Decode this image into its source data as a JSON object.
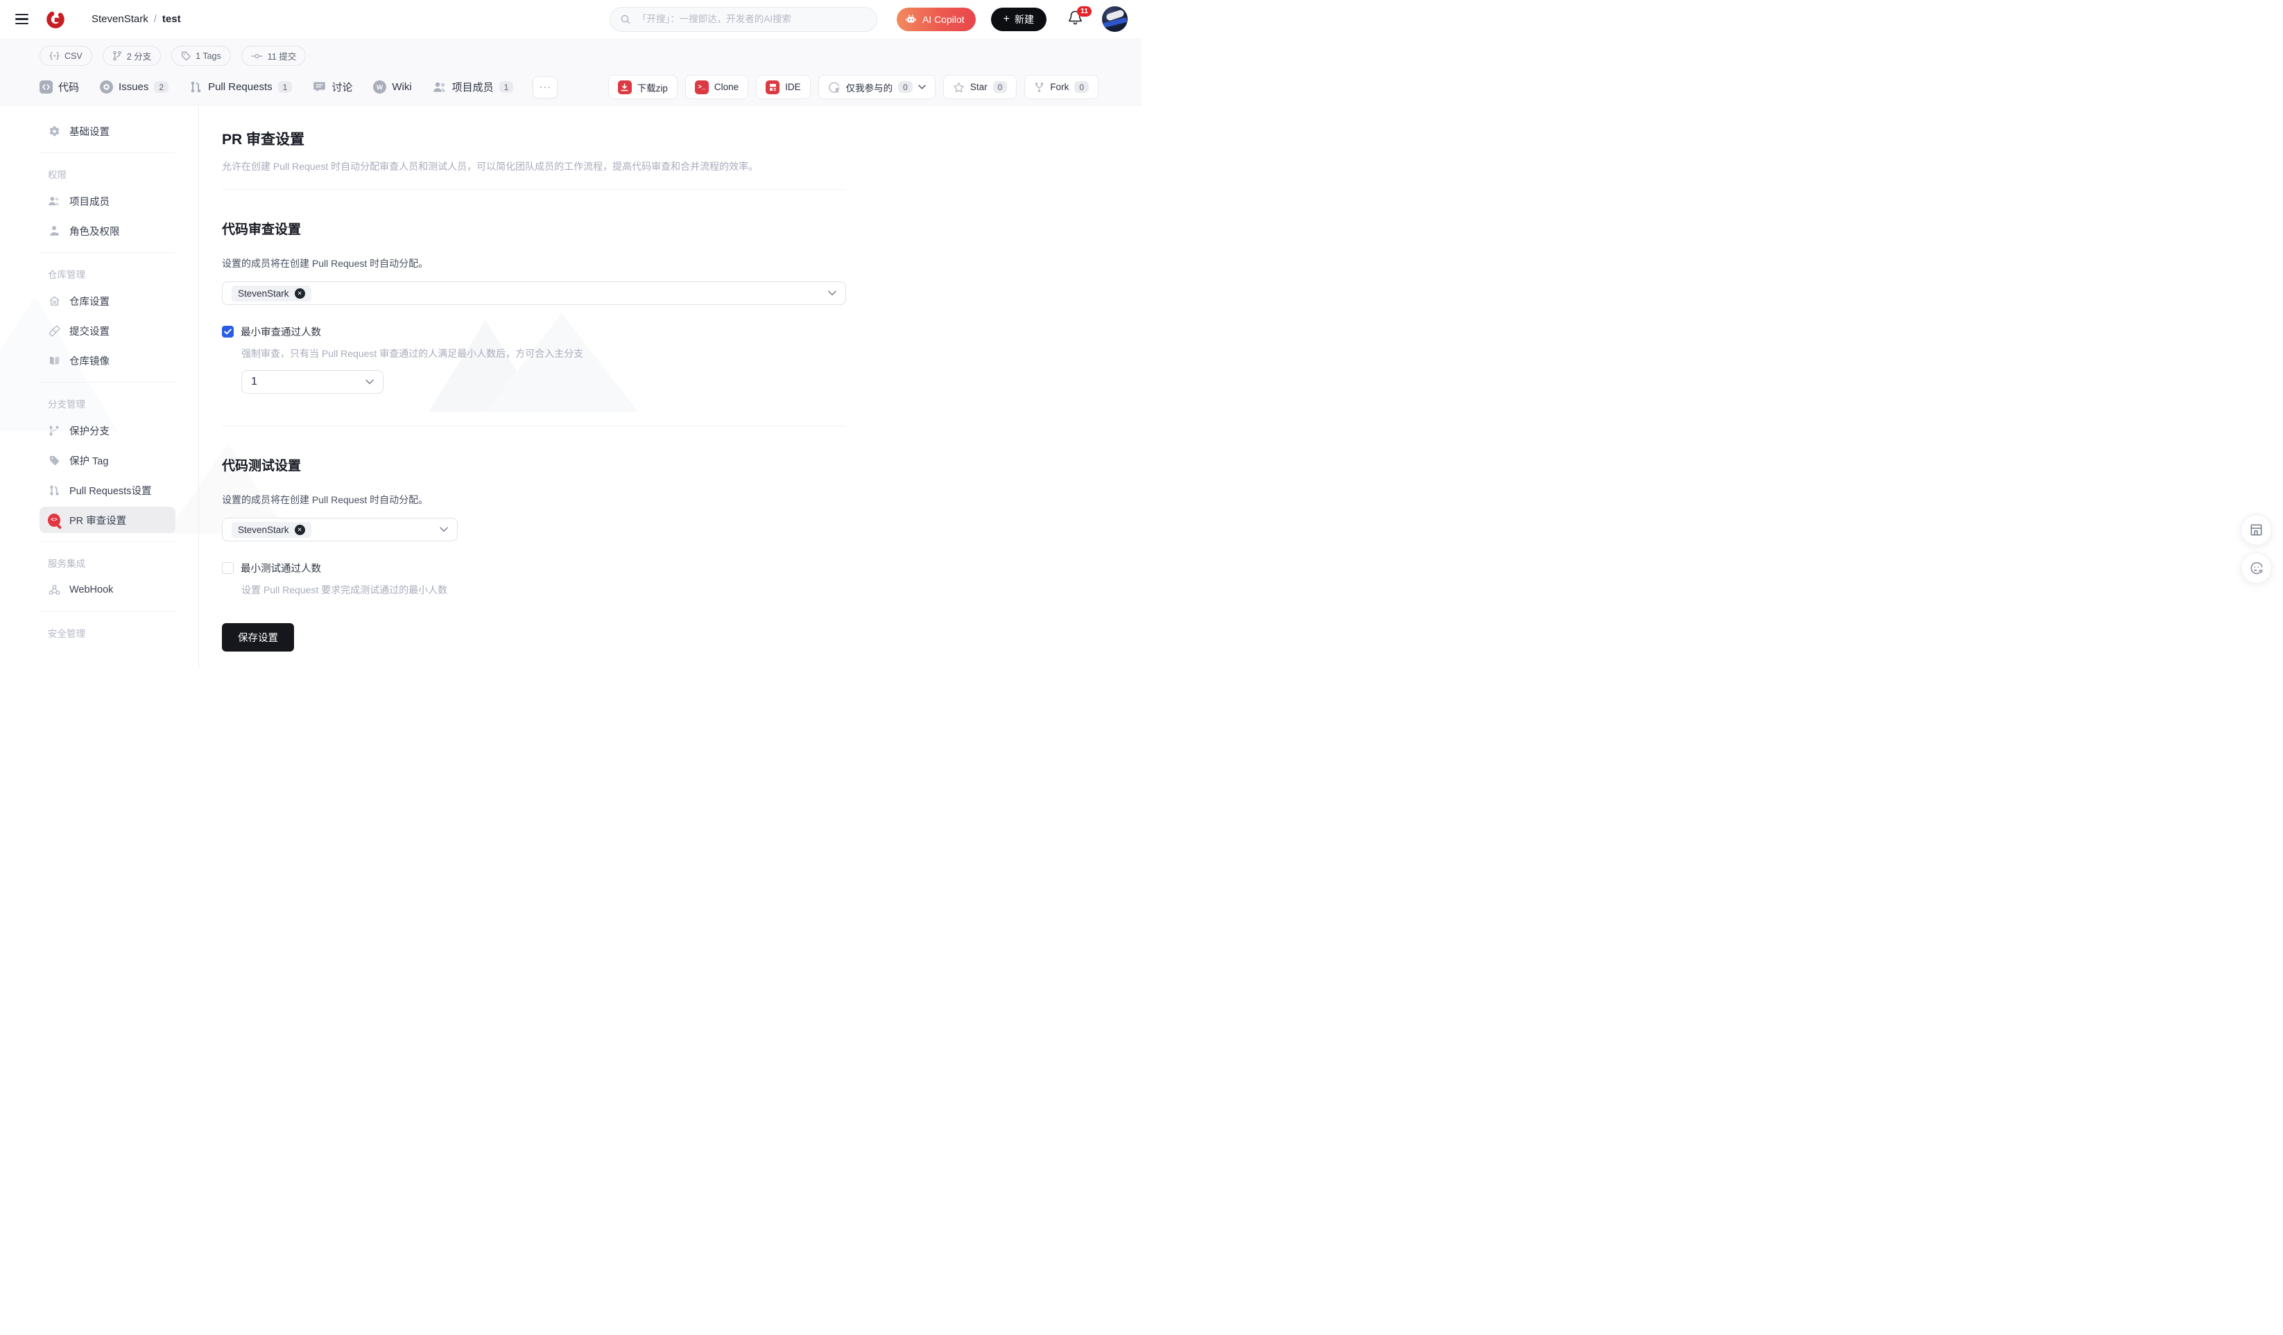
{
  "colors": {
    "brand_red": "#c71d23",
    "button_icon_red": "#dc3a42",
    "copilot_gradient_start": "#f28a5e",
    "copilot_gradient_end": "#e8464b",
    "notification_badge_red": "#e62129",
    "checkbox_blue": "#2b5ce6",
    "save_button_black": "#15171c",
    "active_item_bg": "#ededf0"
  },
  "header": {
    "breadcrumb": {
      "owner": "StevenStark",
      "separator": "/",
      "repo": "test"
    },
    "search_placeholder": "「开搜」：一搜即达，开发者的AI搜索",
    "ai_copilot_label": "AI Copilot",
    "new_label": "新建",
    "new_plus": "+",
    "notification_count": "11"
  },
  "repo": {
    "stats": [
      {
        "icon": "code-language-icon",
        "label": "CSV"
      },
      {
        "icon": "branch-icon",
        "label": "2 分支"
      },
      {
        "icon": "tag-icon",
        "label": "1 Tags"
      },
      {
        "icon": "commit-icon",
        "label": "11 提交"
      }
    ],
    "tabs": [
      {
        "label": "代码"
      },
      {
        "label": "Issues",
        "count": "2"
      },
      {
        "label": "Pull Requests",
        "count": "1"
      },
      {
        "label": "讨论"
      },
      {
        "label": "Wiki"
      },
      {
        "label": "项目成员",
        "count": "1"
      }
    ],
    "more_label": "···",
    "actions": {
      "download_label": "下载zip",
      "clone_label": "Clone",
      "ide_label": "IDE",
      "watch_label": "仅我参与的",
      "watch_count": "0",
      "star_label": "Star",
      "star_count": "0",
      "fork_label": "Fork",
      "fork_count": "0"
    }
  },
  "sidebar": {
    "groups": [
      {
        "items": [
          {
            "label": "基础设置"
          }
        ]
      },
      {
        "header": "权限",
        "items": [
          {
            "label": "项目成员"
          },
          {
            "label": "角色及权限"
          }
        ]
      },
      {
        "header": "仓库管理",
        "items": [
          {
            "label": "仓库设置"
          },
          {
            "label": "提交设置"
          },
          {
            "label": "仓库镜像"
          }
        ]
      },
      {
        "header": "分支管理",
        "items": [
          {
            "label": "保护分支"
          },
          {
            "label": "保护 Tag"
          },
          {
            "label": "Pull Requests设置"
          },
          {
            "label": "PR 审查设置",
            "active": true
          }
        ]
      },
      {
        "header": "服务集成",
        "items": [
          {
            "label": "WebHook"
          }
        ]
      },
      {
        "header": "安全管理",
        "items": []
      }
    ]
  },
  "main": {
    "title": "PR 审查设置",
    "description": "允许在创建 Pull Request 时自动分配审查人员和测试人员，可以简化团队成员的工作流程，提高代码审查和合并流程的效率。",
    "review_section": {
      "heading": "代码审查设置",
      "assign_hint": "设置的成员将在创建 Pull Request 时自动分配。",
      "selected_member": "StevenStark",
      "remove_member_glyph": "✕",
      "min_checkbox_label": "最小审查通过人数",
      "min_checkbox_checked": true,
      "min_hint": "强制审查，只有当 Pull Request 审查通过的人满足最小人数后，方可合入主分支",
      "min_value": "1"
    },
    "test_section": {
      "heading": "代码测试设置",
      "assign_hint": "设置的成员将在创建 Pull Request 时自动分配。",
      "selected_member": "StevenStark",
      "remove_member_glyph": "✕",
      "min_checkbox_label": "最小测试通过人数",
      "min_checkbox_checked": false,
      "min_hint": "设置 Pull Request 要求完成测试通过的最小人数"
    },
    "save_label": "保存设置"
  }
}
